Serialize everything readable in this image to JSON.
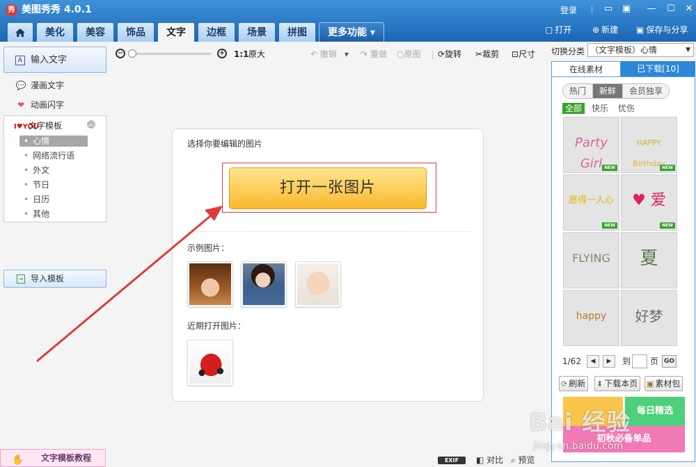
{
  "app": {
    "title": "美图秀秀 4.0.1",
    "logo_glyph": "秀"
  },
  "window": {
    "login": "登录",
    "buttons": [
      "▭",
      "▣",
      "—",
      "☐",
      "✕"
    ]
  },
  "tabs": [
    {
      "label": "",
      "icon": "home-icon"
    },
    {
      "label": "美化"
    },
    {
      "label": "美容"
    },
    {
      "label": "饰品"
    },
    {
      "label": "文字",
      "active": true
    },
    {
      "label": "边框"
    },
    {
      "label": "场景"
    },
    {
      "label": "拼图"
    },
    {
      "label": "更多功能 ▾"
    }
  ],
  "header_actions": {
    "open": "打开",
    "new": "新建",
    "save_share": "保存与分享"
  },
  "left": {
    "input_text": "输入文字",
    "input_icon": "A",
    "manga_text": "漫画文字",
    "anim_text": "动画闪字",
    "template_header": "文字模板",
    "template_icon_text": "I♥YOU",
    "template_items": [
      "心情",
      "网络流行语",
      "外文",
      "节日",
      "日历",
      "其他"
    ],
    "import_template": "导入模板",
    "tutorial": "文字模板教程"
  },
  "toolbar": {
    "zoom_value": 0.0,
    "ratio": "1:1",
    "original_size": "原大",
    "undo": "撤销",
    "redo": "重做",
    "original": "原图",
    "rotate": "旋转",
    "crop": "裁剪",
    "size": "尺寸"
  },
  "card": {
    "hint": "选择你要编辑的图片",
    "open_button": "打开一张图片",
    "sample_label": "示例图片：",
    "recent_label": "近期打开图片："
  },
  "bottom": {
    "exif": "EXIF",
    "compare": "对比",
    "preview": "预览"
  },
  "right": {
    "switch_label": "切换分类",
    "category": "（文字模板）心情",
    "tab_online": "在线素材",
    "tab_downloaded": "已下载[10]",
    "filters": [
      "热门",
      "新鲜",
      "会员独享"
    ],
    "selected_filter": "新鲜",
    "subfilters": [
      "全部",
      "快乐",
      "忧伤"
    ],
    "selected_subfilter": "全部",
    "grid": [
      {
        "art": "Party Girl",
        "new": true
      },
      {
        "art": "HAPPY Birthday",
        "new": true
      },
      {
        "art": "愿得一人心",
        "new": true
      },
      {
        "art": "♥ 爱",
        "new": true
      },
      {
        "art": "FLYING",
        "new": false
      },
      {
        "art": "夏",
        "new": false
      },
      {
        "art": "happy",
        "new": false
      },
      {
        "art": "好梦",
        "new": false
      }
    ],
    "new_badge": "NEW",
    "pager": {
      "current": "1/62",
      "goto": "到",
      "page_unit": "页",
      "go": "GO"
    },
    "refresh": "刷新",
    "download_page": "下载本页",
    "material_pack": "素材包",
    "promo": [
      "每日精选",
      "初秋必备单品"
    ]
  },
  "watermark": {
    "main": "Bai 经验",
    "sub": "jingyan.baidu.com"
  },
  "colors": {
    "accent": "#1b66b5",
    "open_button": "#f9b82c",
    "annotation": "#e03a3a",
    "new_badge": "#3aa02f"
  }
}
